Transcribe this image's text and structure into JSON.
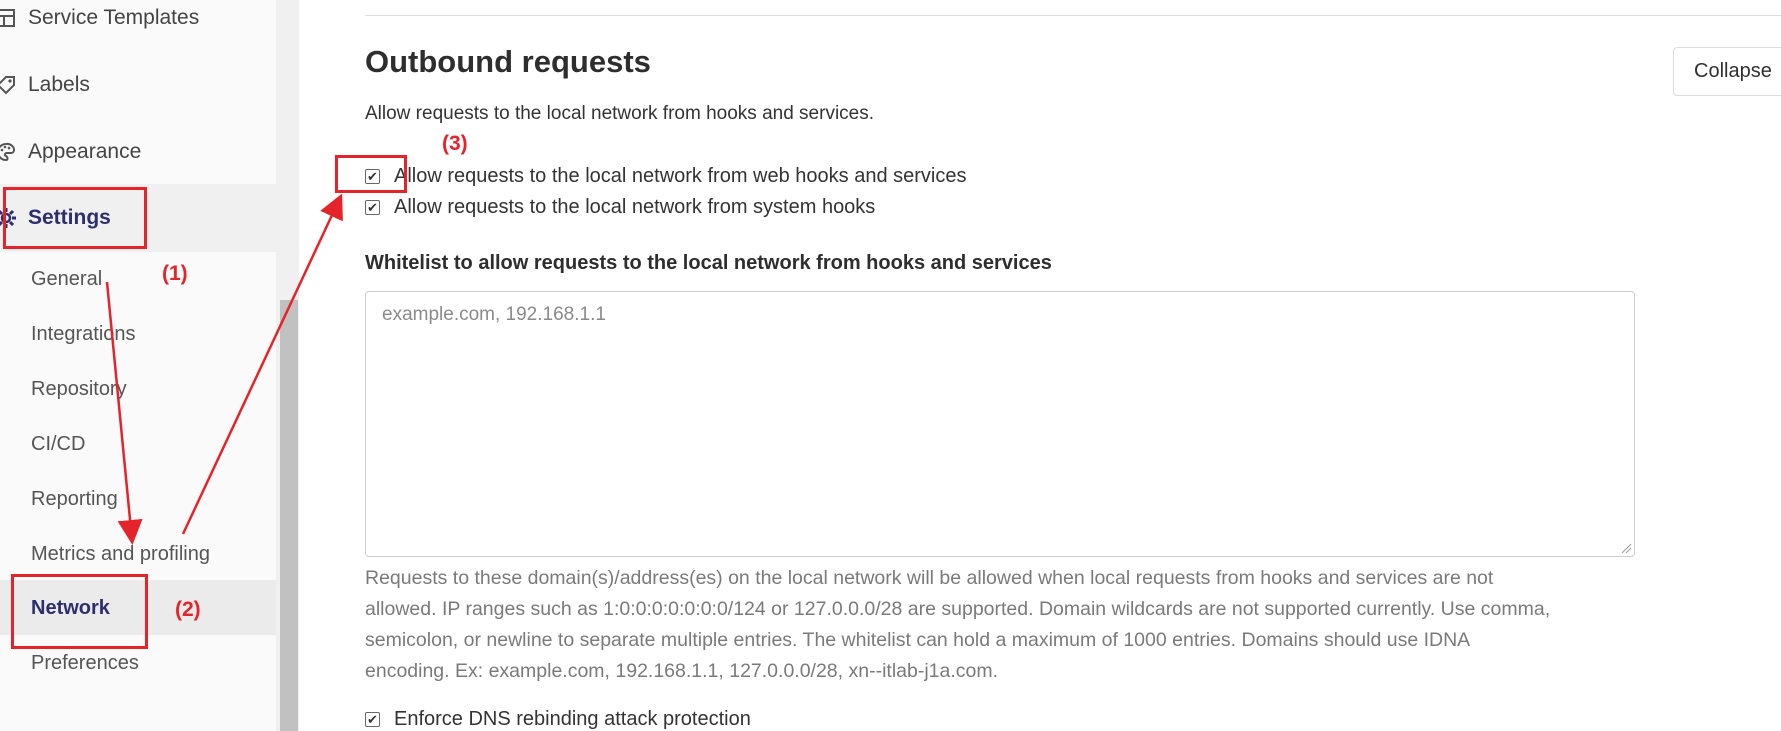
{
  "sidebar": {
    "items": [
      {
        "label": "Service Templates",
        "icon": "template-icon"
      },
      {
        "label": "Labels",
        "icon": "tag-icon"
      },
      {
        "label": "Appearance",
        "icon": "palette-icon"
      },
      {
        "label": "Settings",
        "icon": "gear-icon"
      }
    ],
    "sub_items": [
      {
        "label": "General"
      },
      {
        "label": "Integrations"
      },
      {
        "label": "Repository"
      },
      {
        "label": "CI/CD"
      },
      {
        "label": "Reporting"
      },
      {
        "label": "Metrics and profiling"
      },
      {
        "label": "Network"
      },
      {
        "label": "Preferences"
      }
    ]
  },
  "main": {
    "title": "Outbound requests",
    "description": "Allow requests to the local network from hooks and services.",
    "collapse_label": "Collapse",
    "checkboxes": [
      {
        "label": "Allow requests to the local network from web hooks and services",
        "checked": true
      },
      {
        "label": "Allow requests to the local network from system hooks",
        "checked": true
      }
    ],
    "whitelist": {
      "label": "Whitelist to allow requests to the local network from hooks and services",
      "placeholder": "example.com, 192.168.1.1",
      "value": ""
    },
    "help_lines": [
      "Requests to these domain(s)/address(es) on the local network will be allowed when local requests from hooks and services are not",
      "allowed. IP ranges such as 1:0:0:0:0:0:0:0/124 or 127.0.0.0/28 are supported. Domain wildcards are not supported currently. Use comma,",
      "semicolon, or newline to separate multiple entries. The whitelist can hold a maximum of 1000 entries. Domains should use IDNA",
      "encoding. Ex: example.com, 192.168.1.1, 127.0.0.0/28, xn--itlab-j1a.com."
    ],
    "dns_checkbox": {
      "label": "Enforce DNS rebinding attack protection",
      "checked": true
    }
  },
  "annotations": {
    "step1": "(1)",
    "step2": "(2)",
    "step3": "(3)",
    "color": "#e5232b"
  },
  "colors": {
    "active_nav_text": "#2e2e6e",
    "annotation_red": "#e5232b"
  }
}
